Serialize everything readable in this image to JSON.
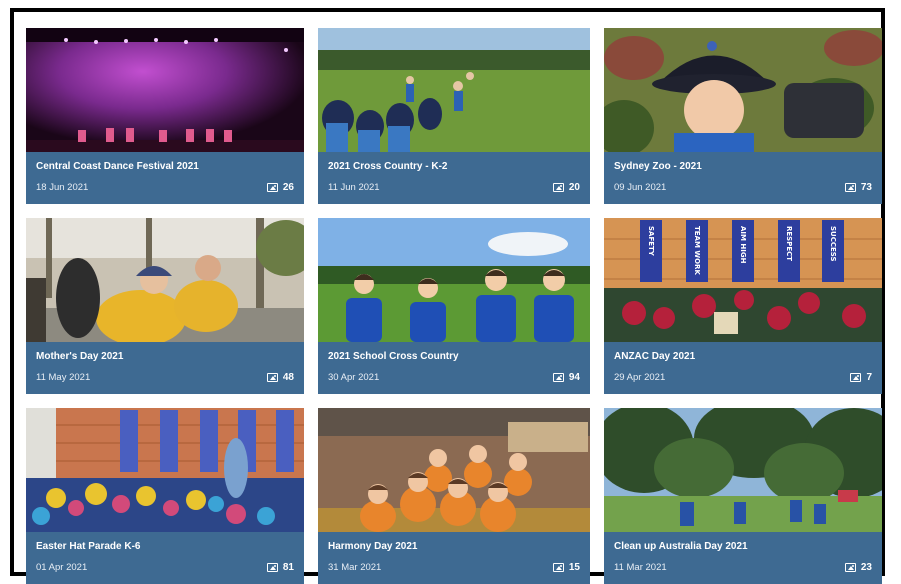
{
  "gallery": {
    "albums": [
      {
        "title": "Central Coast Dance Festival 2021",
        "date": "18 Jun 2021",
        "count": "26",
        "thumb_icon": "stage-photo"
      },
      {
        "title": "2021 Cross Country - K-2",
        "date": "11 Jun 2021",
        "count": "20",
        "thumb_icon": "field-photo"
      },
      {
        "title": "Sydney Zoo - 2021",
        "date": "09 Jun 2021",
        "count": "73",
        "thumb_icon": "child-hat-photo"
      },
      {
        "title": "Mother's Day 2021",
        "date": "11 May 2021",
        "count": "48",
        "thumb_icon": "outdoor-stall-photo"
      },
      {
        "title": "2021 School Cross Country",
        "date": "30 Apr 2021",
        "count": "94",
        "thumb_icon": "students-field-photo"
      },
      {
        "title": "ANZAC Day 2021",
        "date": "29 Apr 2021",
        "count": "7",
        "thumb_icon": "wreaths-photo"
      },
      {
        "title": "Easter Hat Parade K-6",
        "date": "01 Apr 2021",
        "count": "81",
        "thumb_icon": "assembly-photo"
      },
      {
        "title": "Harmony Day 2021",
        "date": "31 Mar 2021",
        "count": "15",
        "thumb_icon": "classroom-group-photo"
      },
      {
        "title": "Clean up Australia Day 2021",
        "date": "11 Mar 2021",
        "count": "23",
        "thumb_icon": "park-photo"
      }
    ],
    "banner_words": [
      "SAFETY",
      "TEAM WORK",
      "AIM HIGH",
      "RESPECT",
      "SUCCESS"
    ]
  }
}
